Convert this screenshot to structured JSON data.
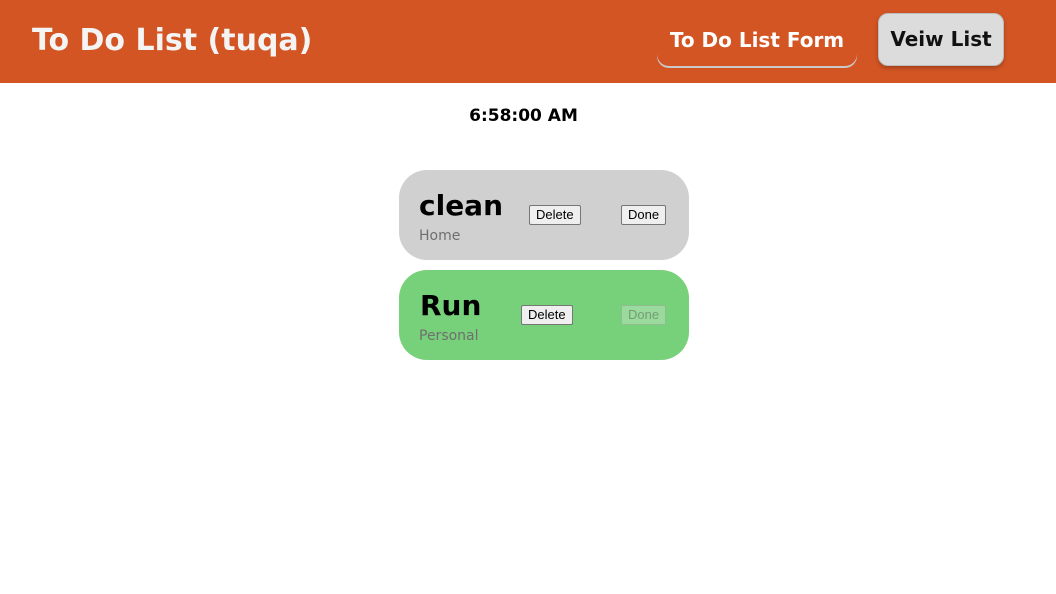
{
  "header": {
    "title": "To Do List (tuqa)",
    "nav": {
      "form_label": "To Do List Form",
      "list_label": "Veiw List"
    }
  },
  "clock": {
    "time": "6:58:00 AM"
  },
  "tasks": [
    {
      "title": "clean",
      "category": "Home",
      "delete_label": "Delete",
      "done_label": "Done",
      "done": false
    },
    {
      "title": "Run",
      "category": "Personal",
      "delete_label": "Delete",
      "done_label": "Done",
      "done": true
    }
  ],
  "colors": {
    "header_bg": "#d35524",
    "pending_card": "#d0d0d0",
    "done_card": "#77d17a"
  }
}
